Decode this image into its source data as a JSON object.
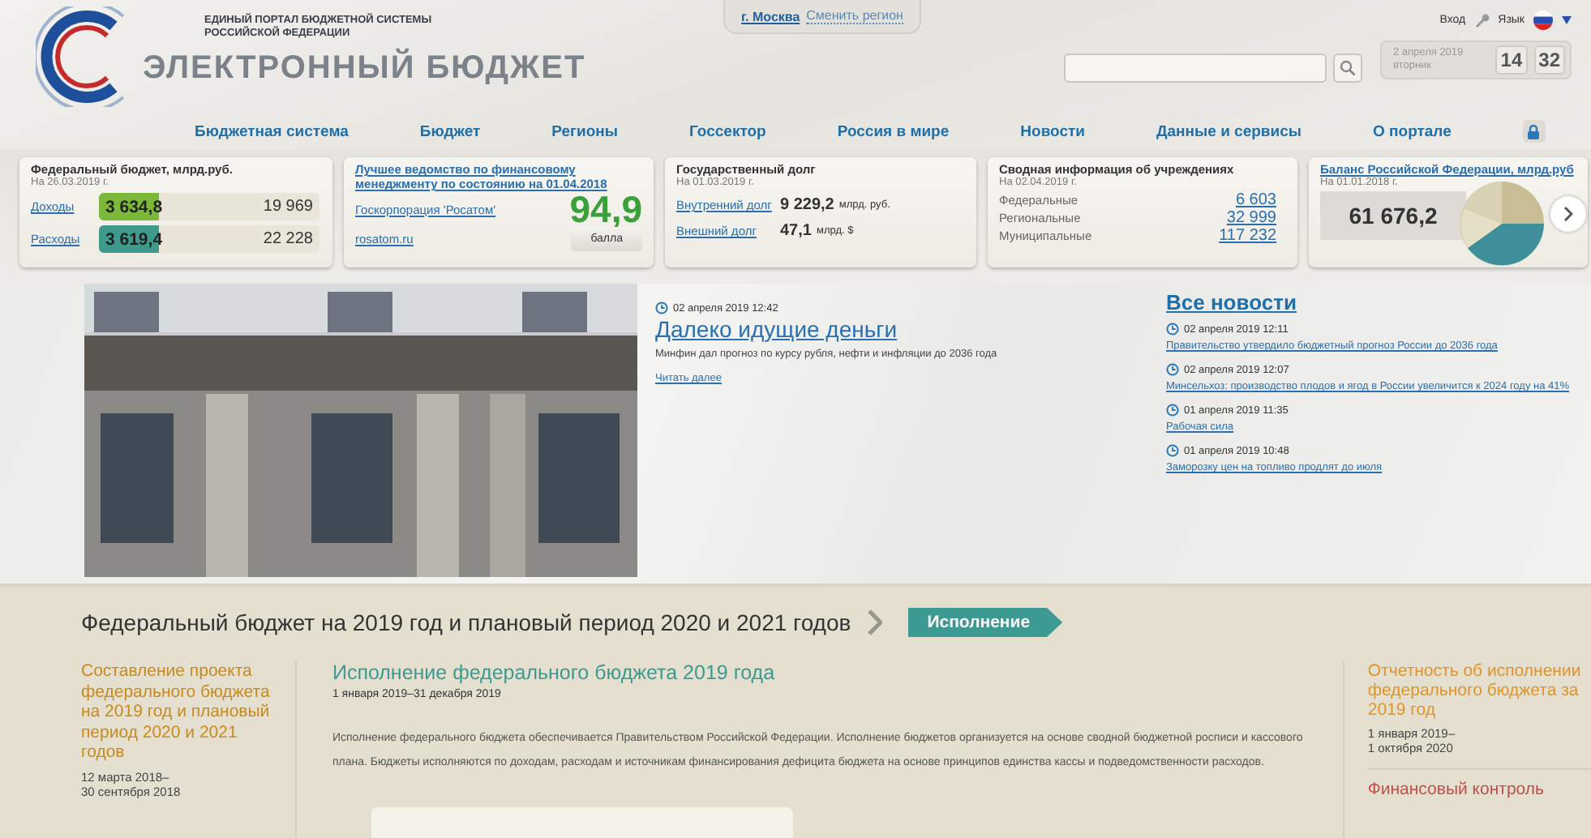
{
  "header": {
    "portal_name": [
      "ЕДИНЫЙ ПОРТАЛ БЮДЖЕТНОЙ СИСТЕМЫ",
      "РОССИЙСКОЙ ФЕДЕРАЦИИ"
    ],
    "site_name": "ЭЛЕКТРОННЫЙ БЮДЖЕТ",
    "region": {
      "city": "г. Москва",
      "change": "Сменить регион"
    },
    "login": "Вход",
    "language": "Язык",
    "date": "2 апреля 2019",
    "weekday": "вторник",
    "hours": "14",
    "minutes": "32"
  },
  "nav": [
    "Бюджетная система",
    "Бюджет",
    "Регионы",
    "Госсектор",
    "Россия в мире",
    "Новости",
    "Данные и сервисы",
    "О портале"
  ],
  "widgets": {
    "budget": {
      "title": "Федеральный бюджет, млрд.руб.",
      "date": "На 26.03.2019 г.",
      "rows": [
        {
          "label": "Доходы",
          "current": "3 634,8",
          "total": "19 969",
          "level": 0.27,
          "color": "#7cb83a"
        },
        {
          "label": "Расходы",
          "current": "3 619,4",
          "total": "22 228",
          "level": 0.27,
          "color": "#3f9a8c"
        }
      ]
    },
    "rating": {
      "title": "Лучшее ведомство по финансовому менеджменту по состоянию на 01.04.2018",
      "org": "Госкорпорация 'Росатом'",
      "site": "rosatom.ru",
      "score": "94,9",
      "unit": "балла"
    },
    "debt": {
      "title": "Государственный долг",
      "date": "На 01.03.2019 г.",
      "rows": [
        {
          "label": "Внутренний долг",
          "value": "9 229,2",
          "unit": "млрд. руб."
        },
        {
          "label": "Внешний долг",
          "value": "47,1",
          "unit": "млрд. $"
        }
      ]
    },
    "institutions": {
      "title": "Сводная информация об учреждениях",
      "date": "На 02.04.2019 г.",
      "rows": [
        {
          "label": "Федеральные",
          "value": "6 603"
        },
        {
          "label": "Региональные",
          "value": "32 999"
        },
        {
          "label": "Муниципальные",
          "value": "117 232"
        }
      ]
    },
    "balance": {
      "title": "Баланс Российской Федерации, млрд.руб",
      "date": "На 01.01.2018 г.",
      "value": "61 676,2"
    }
  },
  "news": {
    "main": {
      "kind": "picture",
      "date": "02 апреля 2019 12:42",
      "title": "Далеко идущие деньги",
      "summary": "Минфин дал прогноз по курсу рубля, нефти и инфляции до 2036 года",
      "more": "Читать далее"
    },
    "all_title": "Все новости",
    "items": [
      {
        "date": "02 апреля 2019 12:11",
        "title": "Правительство утвердило бюджетный прогноз России до 2036 года"
      },
      {
        "date": "02 апреля 2019 12:07",
        "title": "Минсельхоз: производство плодов и ягод в России увеличится к 2024 году на 41%"
      },
      {
        "date": "01 апреля 2019 11:35",
        "title": "Рабочая сила"
      },
      {
        "date": "01 апреля 2019 10:48",
        "title": "Заморозку цен на топливо продлят до июля"
      }
    ]
  },
  "budget": {
    "heading": "Федеральный бюджет на 2019 год и плановый период 2020 и 2021 годов",
    "stage": "Исполнение",
    "left": {
      "title": "Составление проекта федерального бюджета на 2019 год и плановый период 2020 и 2021 годов",
      "dates": [
        "12 марта 2018–",
        "30 сентября 2018"
      ]
    },
    "center": {
      "title": "Исполнение федерального бюджета 2019 года",
      "dates": "1 января 2019–31 декабря 2019",
      "text": "Исполнение федерального бюджета обеспечивается Правительством Российской Федерации. Исполнение бюджетов организуется на основе сводной бюджетной росписи и кассового плана. Бюджеты исполняются по доходам, расходам и источникам финансирования дефицита бюджета на основе принципов единства кассы и подведомственности расходов."
    },
    "right": [
      {
        "title": "Отчетность об исполнении федерального бюджета за 2019 год",
        "dates": [
          "1 января 2019–",
          "1 октября 2020"
        ],
        "color": "#e0952a"
      },
      {
        "title": "Финансовый контроль",
        "color": "#c0504d"
      }
    ]
  }
}
